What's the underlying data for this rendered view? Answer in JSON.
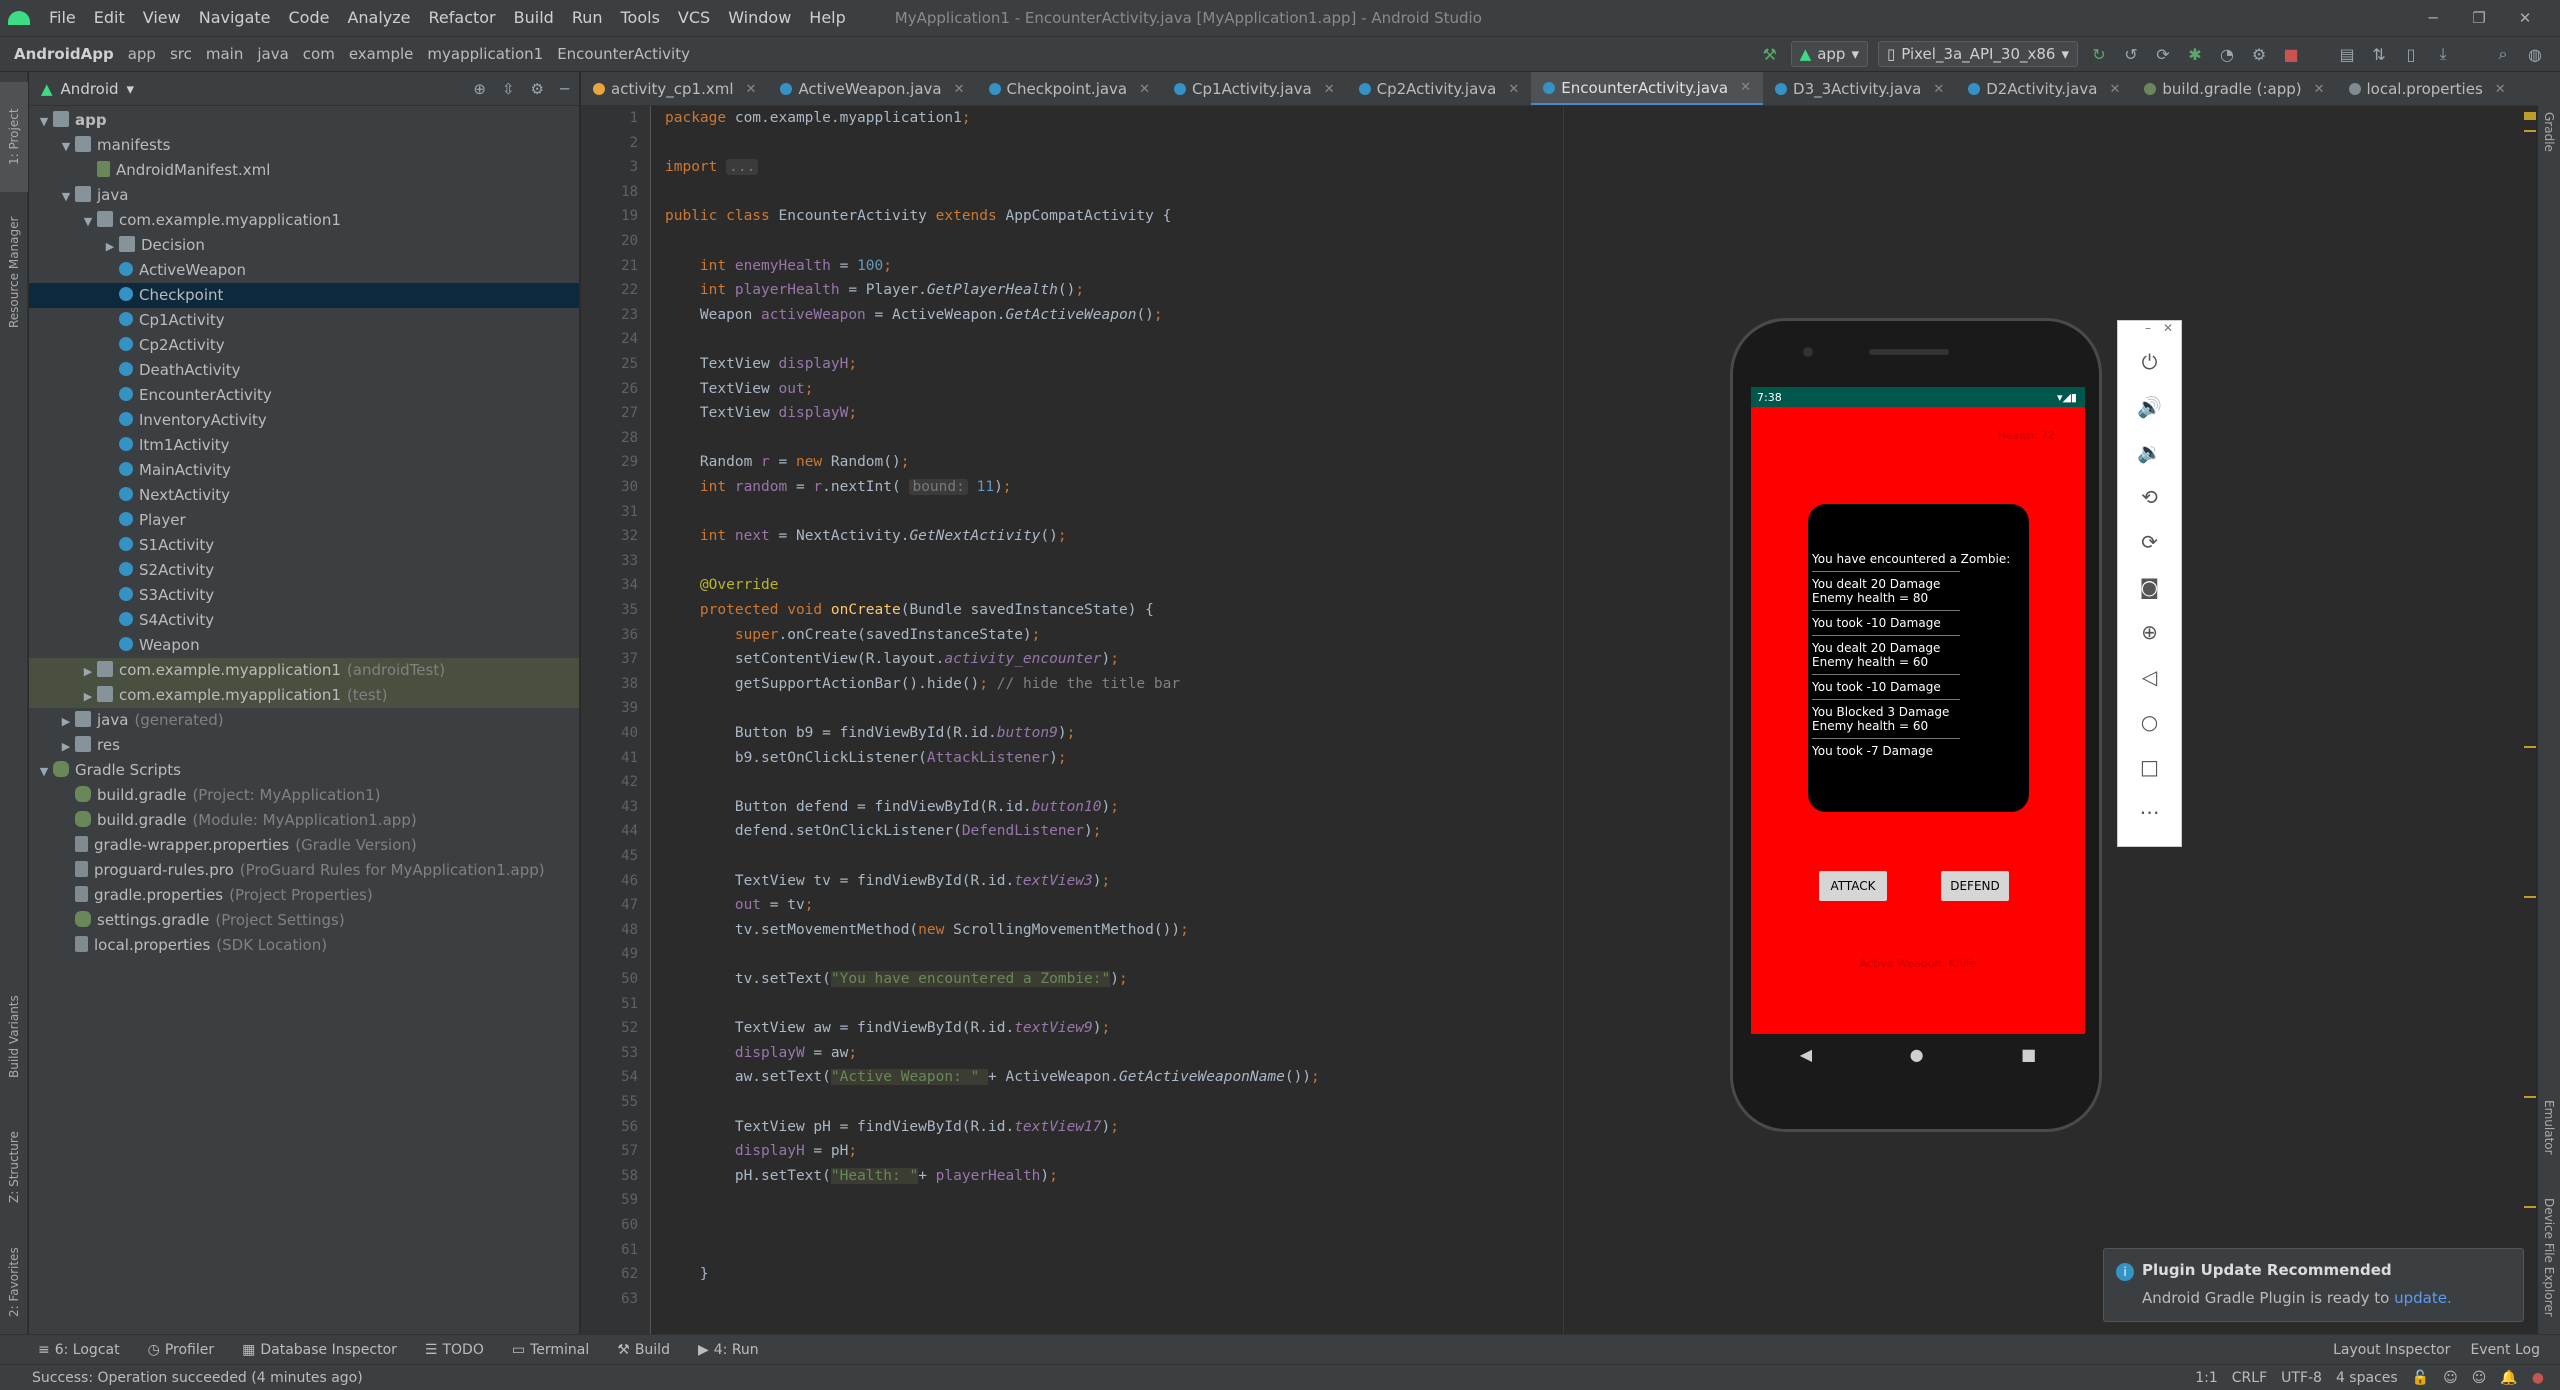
{
  "menubar": {
    "items": [
      "File",
      "Edit",
      "View",
      "Navigate",
      "Code",
      "Analyze",
      "Refactor",
      "Build",
      "Run",
      "Tools",
      "VCS",
      "Window",
      "Help"
    ],
    "title": "MyApplication1 - EncounterActivity.java [MyApplication1.app] - Android Studio"
  },
  "breadcrumb": [
    "AndroidApp",
    "app",
    "src",
    "main",
    "java",
    "com",
    "example",
    "myapplication1",
    "EncounterActivity"
  ],
  "toolbar": {
    "run_config": "app",
    "device": "Pixel_3a_API_30_x86"
  },
  "left_tabs": [
    "1: Project",
    "Resource Manager",
    "Build Variants",
    "Z: Structure",
    "2: Favorites"
  ],
  "right_tabs": [
    "Gradle",
    "Emulator",
    "Device File Explorer"
  ],
  "project": {
    "view_label": "Android",
    "tree": [
      {
        "label": "app",
        "hint": "",
        "indent": 0,
        "arrow": "▼",
        "icon": "folder",
        "bold": true
      },
      {
        "label": "manifests",
        "hint": "",
        "indent": 1,
        "arrow": "▼",
        "icon": "folder"
      },
      {
        "label": "AndroidManifest.xml",
        "hint": "",
        "indent": 2,
        "arrow": "",
        "icon": "xml"
      },
      {
        "label": "java",
        "hint": "",
        "indent": 1,
        "arrow": "▼",
        "icon": "folder"
      },
      {
        "label": "com.example.myapplication1",
        "hint": "",
        "indent": 2,
        "arrow": "▼",
        "icon": "folder"
      },
      {
        "label": "Decision",
        "hint": "",
        "indent": 3,
        "arrow": "▶",
        "icon": "folder"
      },
      {
        "label": "ActiveWeapon",
        "hint": "",
        "indent": 3,
        "arrow": "",
        "icon": "cls"
      },
      {
        "label": "Checkpoint",
        "hint": "",
        "indent": 3,
        "arrow": "",
        "icon": "cls",
        "selected": true
      },
      {
        "label": "Cp1Activity",
        "hint": "",
        "indent": 3,
        "arrow": "",
        "icon": "cls"
      },
      {
        "label": "Cp2Activity",
        "hint": "",
        "indent": 3,
        "arrow": "",
        "icon": "cls"
      },
      {
        "label": "DeathActivity",
        "hint": "",
        "indent": 3,
        "arrow": "",
        "icon": "cls"
      },
      {
        "label": "EncounterActivity",
        "hint": "",
        "indent": 3,
        "arrow": "",
        "icon": "cls"
      },
      {
        "label": "InventoryActivity",
        "hint": "",
        "indent": 3,
        "arrow": "",
        "icon": "cls"
      },
      {
        "label": "Itm1Activity",
        "hint": "",
        "indent": 3,
        "arrow": "",
        "icon": "cls"
      },
      {
        "label": "MainActivity",
        "hint": "",
        "indent": 3,
        "arrow": "",
        "icon": "cls"
      },
      {
        "label": "NextActivity",
        "hint": "",
        "indent": 3,
        "arrow": "",
        "icon": "cls"
      },
      {
        "label": "Player",
        "hint": "",
        "indent": 3,
        "arrow": "",
        "icon": "cls"
      },
      {
        "label": "S1Activity",
        "hint": "",
        "indent": 3,
        "arrow": "",
        "icon": "cls"
      },
      {
        "label": "S2Activity",
        "hint": "",
        "indent": 3,
        "arrow": "",
        "icon": "cls"
      },
      {
        "label": "S3Activity",
        "hint": "",
        "indent": 3,
        "arrow": "",
        "icon": "cls"
      },
      {
        "label": "S4Activity",
        "hint": "",
        "indent": 3,
        "arrow": "",
        "icon": "cls"
      },
      {
        "label": "Weapon",
        "hint": "",
        "indent": 3,
        "arrow": "",
        "icon": "cls"
      },
      {
        "label": "com.example.myapplication1",
        "hint": "(androidTest)",
        "indent": 2,
        "arrow": "▶",
        "icon": "folder",
        "module": true
      },
      {
        "label": "com.example.myapplication1",
        "hint": "(test)",
        "indent": 2,
        "arrow": "▶",
        "icon": "folder",
        "module": true
      },
      {
        "label": "java",
        "hint": "(generated)",
        "indent": 1,
        "arrow": "▶",
        "icon": "folder"
      },
      {
        "label": "res",
        "hint": "",
        "indent": 1,
        "arrow": "▶",
        "icon": "folder"
      },
      {
        "label": "Gradle Scripts",
        "hint": "",
        "indent": 0,
        "arrow": "▼",
        "icon": "gradle"
      },
      {
        "label": "build.gradle",
        "hint": "(Project: MyApplication1)",
        "indent": 1,
        "arrow": "",
        "icon": "gradle"
      },
      {
        "label": "build.gradle",
        "hint": "(Module: MyApplication1.app)",
        "indent": 1,
        "arrow": "",
        "icon": "gradle"
      },
      {
        "label": "gradle-wrapper.properties",
        "hint": "(Gradle Version)",
        "indent": 1,
        "arrow": "",
        "icon": "props"
      },
      {
        "label": "proguard-rules.pro",
        "hint": "(ProGuard Rules for MyApplication1.app)",
        "indent": 1,
        "arrow": "",
        "icon": "props"
      },
      {
        "label": "gradle.properties",
        "hint": "(Project Properties)",
        "indent": 1,
        "arrow": "",
        "icon": "props"
      },
      {
        "label": "settings.gradle",
        "hint": "(Project Settings)",
        "indent": 1,
        "arrow": "",
        "icon": "gradle"
      },
      {
        "label": "local.properties",
        "hint": "(SDK Location)",
        "indent": 1,
        "arrow": "",
        "icon": "props"
      }
    ]
  },
  "tabs": [
    {
      "label": "activity_cp1.xml",
      "color": "#e8a33d"
    },
    {
      "label": "ActiveWeapon.java",
      "color": "#3592c4"
    },
    {
      "label": "Checkpoint.java",
      "color": "#3592c4"
    },
    {
      "label": "Cp1Activity.java",
      "color": "#3592c4"
    },
    {
      "label": "Cp2Activity.java",
      "color": "#3592c4"
    },
    {
      "label": "EncounterActivity.java",
      "color": "#3592c4",
      "active": true
    },
    {
      "label": "D3_3Activity.java",
      "color": "#3592c4"
    },
    {
      "label": "D2Activity.java",
      "color": "#3592c4"
    },
    {
      "label": "build.gradle (:app)",
      "color": "#6a8759"
    },
    {
      "label": "local.properties",
      "color": "#7f8b91"
    }
  ],
  "code": [
    {
      "n": "1",
      "html": "<span class=\"kw\">package </span>com.example.myapplication1<span class=\"kw\">;</span>"
    },
    {
      "n": "2",
      "html": ""
    },
    {
      "n": "3",
      "html": "<span class=\"kw\">import </span><span class=\"hintbox\">...</span>"
    },
    {
      "n": "18",
      "html": ""
    },
    {
      "n": "19",
      "html": "<span class=\"kw\">public class </span>EncounterActivity <span class=\"kw\">extends </span>AppCompatActivity {"
    },
    {
      "n": "20",
      "html": ""
    },
    {
      "n": "21",
      "html": "    <span class=\"kw\">int </span><span class=\"fld\">enemyHealth </span>= <span class=\"num\">100</span><span class=\"kw\">;</span>"
    },
    {
      "n": "22",
      "html": "    <span class=\"kw\">int </span><span class=\"fld\">playerHealth </span>= Player.<span class=\"it\">GetPlayerHealth</span>()<span class=\"kw\">;</span>"
    },
    {
      "n": "23",
      "html": "    Weapon <span class=\"fld\">activeWeapon </span>= ActiveWeapon.<span class=\"it\">GetActiveWeapon</span>()<span class=\"kw\">;</span>"
    },
    {
      "n": "24",
      "html": ""
    },
    {
      "n": "25",
      "html": "    TextView <span class=\"fld\">displayH</span><span class=\"kw\">;</span>"
    },
    {
      "n": "26",
      "html": "    TextView <span class=\"fld\">out</span><span class=\"kw\">;</span>"
    },
    {
      "n": "27",
      "html": "    TextView <span class=\"fld\">displayW</span><span class=\"kw\">;</span>"
    },
    {
      "n": "28",
      "html": ""
    },
    {
      "n": "29",
      "html": "    Random <span class=\"fld\">r </span>= <span class=\"kw\">new </span>Random()<span class=\"kw\">;</span>"
    },
    {
      "n": "30",
      "html": "    <span class=\"kw\">int </span><span class=\"fld\">random </span>= <span class=\"fld\">r</span>.nextInt( <span class=\"hintbox\">bound:</span> <span class=\"num\">11</span>)<span class=\"kw\">;</span>"
    },
    {
      "n": "31",
      "html": ""
    },
    {
      "n": "32",
      "html": "    <span class=\"kw\">int </span><span class=\"fld\">next </span>= NextActivity.<span class=\"it\">GetNextActivity</span>()<span class=\"kw\">;</span>"
    },
    {
      "n": "33",
      "html": ""
    },
    {
      "n": "34",
      "html": "    <span class=\"ann\">@Override</span>"
    },
    {
      "n": "35",
      "html": "    <span class=\"kw\">protected void </span><span class=\"fn\">onCreate</span>(Bundle savedInstanceState) {"
    },
    {
      "n": "36",
      "html": "        <span class=\"kw\">super</span>.onCreate(savedInstanceState)<span class=\"kw\">;</span>"
    },
    {
      "n": "37",
      "html": "        setContentView(R.layout.<span class=\"fld it\">activity_encounter</span>)<span class=\"kw\">;</span>"
    },
    {
      "n": "38",
      "html": "        getSupportActionBar().hide()<span class=\"kw\">; </span><span class=\"com\">// hide the title bar</span>"
    },
    {
      "n": "39",
      "html": ""
    },
    {
      "n": "40",
      "html": "        Button b9 = findViewById(R.id.<span class=\"fld it\">button9</span>)<span class=\"kw\">;</span>"
    },
    {
      "n": "41",
      "html": "        b9.setOnClickListener(<span class=\"fld\">AttackListener</span>)<span class=\"kw\">;</span>"
    },
    {
      "n": "42",
      "html": ""
    },
    {
      "n": "43",
      "html": "        Button defend = findViewById(R.id.<span class=\"fld it\">button10</span>)<span class=\"kw\">;</span>"
    },
    {
      "n": "44",
      "html": "        defend.setOnClickListener(<span class=\"fld\">DefendListener</span>)<span class=\"kw\">;</span>"
    },
    {
      "n": "45",
      "html": ""
    },
    {
      "n": "46",
      "html": "        TextView tv = findViewById(R.id.<span class=\"fld it\">textView3</span>)<span class=\"kw\">;</span>"
    },
    {
      "n": "47",
      "html": "        <span class=\"fld\">out </span>= tv<span class=\"kw\">;</span>"
    },
    {
      "n": "48",
      "html": "        tv.setMovementMethod(<span class=\"kw\">new </span>ScrollingMovementMethod())<span class=\"kw\">;</span>"
    },
    {
      "n": "49",
      "html": ""
    },
    {
      "n": "50",
      "html": "        tv.setText(<span class=\"str\">\"You have encountered a Zombie:\"</span>)<span class=\"kw\">;</span>"
    },
    {
      "n": "51",
      "html": ""
    },
    {
      "n": "52",
      "html": "        TextView aw = findViewById(R.id.<span class=\"fld it\">textView9</span>)<span class=\"kw\">;</span>"
    },
    {
      "n": "53",
      "html": "        <span class=\"fld\">displayW </span>= aw<span class=\"kw\">;</span>"
    },
    {
      "n": "54",
      "html": "        aw.setText(<span class=\"str\">\"Active Weapon: \" </span>+ ActiveWeapon.<span class=\"it\">GetActiveWeaponName</span>())<span class=\"kw\">;</span>"
    },
    {
      "n": "55",
      "html": ""
    },
    {
      "n": "56",
      "html": "        TextView pH = findViewById(R.id.<span class=\"fld it\">textView17</span>)<span class=\"kw\">;</span>"
    },
    {
      "n": "57",
      "html": "        <span class=\"fld\">displayH </span>= pH<span class=\"kw\">;</span>"
    },
    {
      "n": "58",
      "html": "        pH.setText(<span class=\"str\">\"Health: \"</span>+ <span class=\"fld\">playerHealth</span>)<span class=\"kw\">;</span>"
    },
    {
      "n": "59",
      "html": ""
    },
    {
      "n": "60",
      "html": ""
    },
    {
      "n": "61",
      "html": ""
    },
    {
      "n": "62",
      "html": "    }"
    },
    {
      "n": "63",
      "html": ""
    }
  ],
  "emulator": {
    "time": "7:38",
    "health_text": "Health: 72",
    "lines": [
      "You have encountered a Zombie:",
      "You dealt 20 Damage",
      "Enemy health = 80",
      "You took -10 Damage",
      "You dealt 20 Damage",
      "Enemy health = 60",
      "You took -10 Damage",
      "You Blocked 3 Damage",
      "Enemy health = 60",
      "You took -7 Damage"
    ],
    "attack_label": "ATTACK",
    "defend_label": "DEFEND",
    "weapon_text": "Active Weapon: Knife"
  },
  "notification": {
    "title": "Plugin Update Recommended",
    "body": "Android Gradle Plugin is ready to ",
    "link": "update."
  },
  "toolwindows": [
    "6: Logcat",
    "Profiler",
    "Database Inspector",
    "TODO",
    "Terminal",
    "Build",
    "4: Run"
  ],
  "toolwindows_right": [
    "Layout Inspector",
    "Event Log"
  ],
  "statusbar": {
    "message": "Success: Operation succeeded (4 minutes ago)",
    "position": "1:1",
    "line_sep": "CRLF",
    "encoding": "UTF-8",
    "indent": "4 spaces"
  }
}
